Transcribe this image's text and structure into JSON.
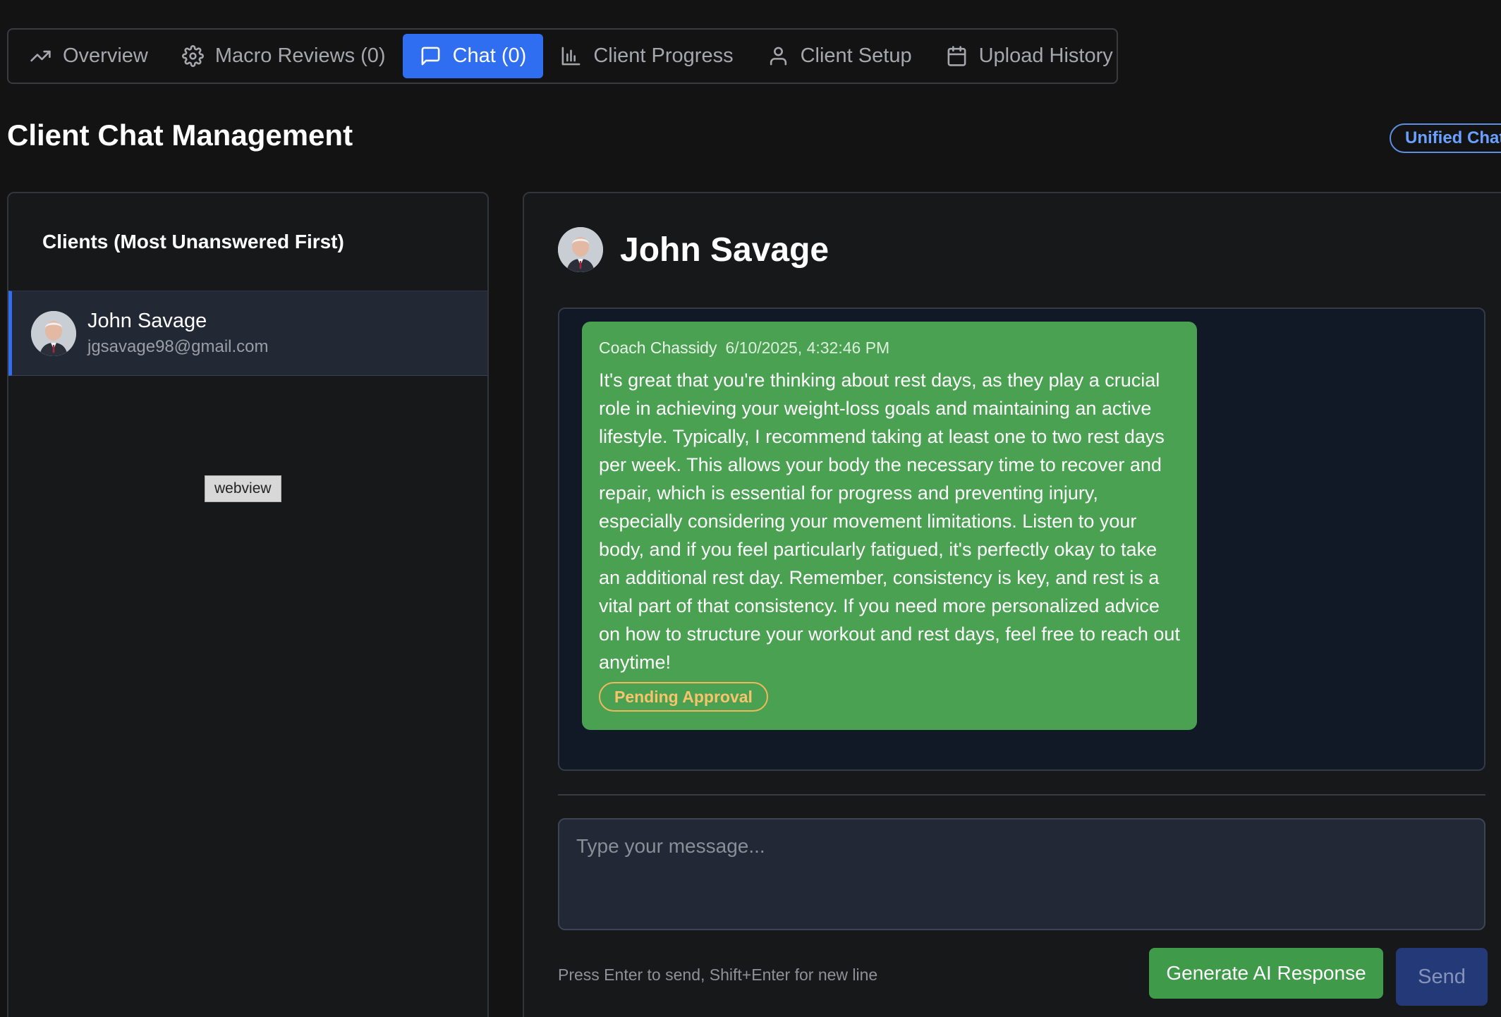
{
  "tabs": [
    {
      "label": "Overview",
      "icon": "trending-up-icon",
      "active": false
    },
    {
      "label": "Macro Reviews (0)",
      "icon": "gear-icon",
      "active": false
    },
    {
      "label": "Chat (0)",
      "icon": "message-square-icon",
      "active": true
    },
    {
      "label": "Client Progress",
      "icon": "bar-chart-icon",
      "active": false
    },
    {
      "label": "Client Setup",
      "icon": "user-icon",
      "active": false
    },
    {
      "label": "Upload History",
      "icon": "calendar-icon",
      "active": false
    }
  ],
  "page": {
    "title": "Client Chat Management",
    "badge": "Unified Chat"
  },
  "clients": {
    "header": "Clients (Most Unanswered First)",
    "items": [
      {
        "name": "John Savage",
        "email": "jgsavage98@gmail.com"
      }
    ],
    "webview_label": "webview"
  },
  "chat": {
    "client_name": "John Savage",
    "messages": [
      {
        "sender": "Coach Chassidy",
        "timestamp": "6/10/2025, 4:32:46 PM",
        "body": "It's great that you're thinking about rest days, as they play a crucial role in achieving your weight-loss goals and maintaining an active lifestyle. Typically, I recommend taking at least one to two rest days per week. This allows your body the necessary time to recover and repair, which is essential for progress and preventing injury, especially considering your movement limitations. Listen to your body, and if you feel particularly fatigued, it's perfectly okay to take an additional rest day. Remember, consistency is key, and rest is a vital part of that consistency. If you need more personalized advice on how to structure your workout and rest days, feel free to reach out anytime!",
        "status": "Pending Approval"
      }
    ],
    "input_placeholder": "Type your message...",
    "input_value": "",
    "hint": "Press Enter to send, Shift+Enter for new line",
    "ai_button": "Generate AI Response",
    "send_button": "Send"
  },
  "colors": {
    "accent": "#2f6ef0",
    "message_bg": "#4aa152",
    "pending": "#f0b85a",
    "background": "#131314"
  }
}
